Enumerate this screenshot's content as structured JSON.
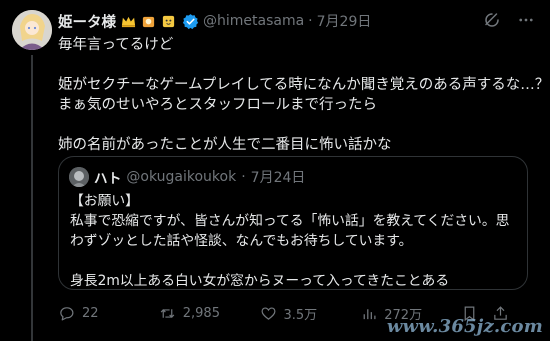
{
  "tweet": {
    "display_name": "姫ータ様",
    "handle": "@himetasama",
    "separator": "·",
    "time": "7月29日",
    "lines": [
      "毎年言ってるけど",
      "",
      "姫がセクチーなゲームプレイしてる時になんか聞き覚えのある声するな…？",
      "まぁ気のせいやろとスタッフロールまで行ったら",
      "",
      "姉の名前があったことが人生で二番目に怖い話かな"
    ]
  },
  "quote": {
    "display_name": "ハト",
    "handle": "@okugaikoukok",
    "separator": "·",
    "time": "7月24日",
    "lines": [
      "【お願い】",
      "私事で恐縮ですが、皆さんが知ってる「怖い話」を教えてください。思",
      "わずゾッとした話や怪談、なんでもお待ちしています。",
      "",
      "身長2m以上ある白い女が窓からヌーって入ってきたことある"
    ]
  },
  "actions": {
    "replies": "22",
    "reposts": "2,985",
    "likes": "3.5万",
    "views": "272万"
  },
  "icons": {
    "verified": "verified-badge-icon",
    "grok": "grok-icon",
    "more": "more-icon",
    "reply": "reply-icon",
    "repost": "repost-icon",
    "like": "like-icon",
    "views": "views-icon",
    "bookmark": "bookmark-icon",
    "share": "share-icon"
  },
  "colors": {
    "background": "#000000",
    "text": "#e7e9ea",
    "secondary": "#71767b",
    "border": "#2f3336",
    "verified": "#1d9bf0"
  },
  "watermark": "www.365jz.com"
}
